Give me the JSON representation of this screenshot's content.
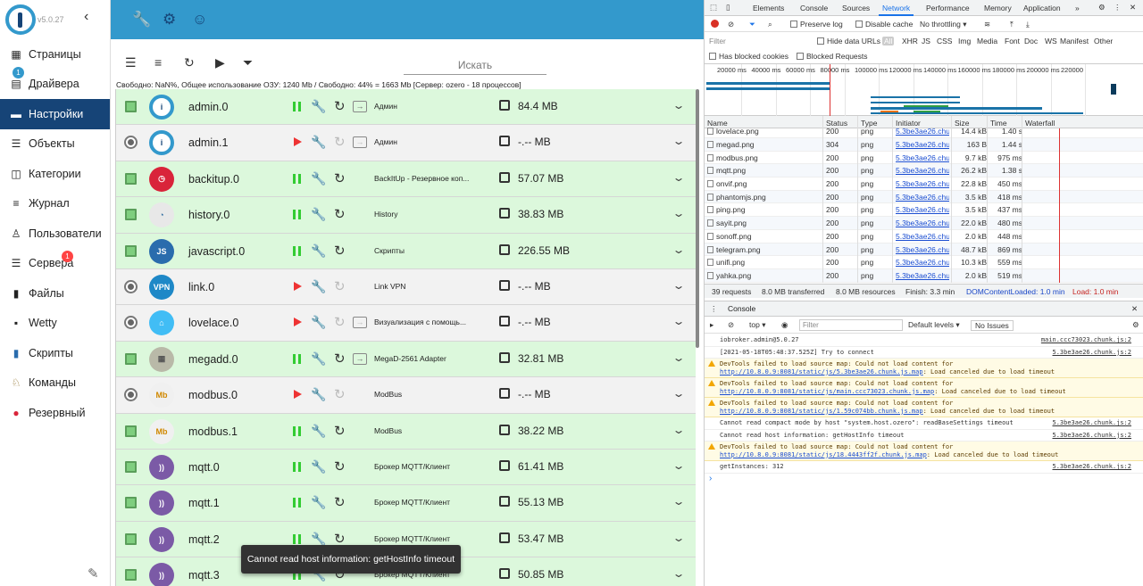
{
  "sidebar": {
    "version": "v5.0.27",
    "items": [
      {
        "label": "Страницы",
        "icon": "grid-icon"
      },
      {
        "label": "Драйвера",
        "icon": "store-icon",
        "badge": "1"
      },
      {
        "label": "Настройки",
        "icon": "list-icon",
        "active": true
      },
      {
        "label": "Объекты",
        "icon": "table-icon"
      },
      {
        "label": "Категории",
        "icon": "tag-icon"
      },
      {
        "label": "Журнал",
        "icon": "log-icon"
      },
      {
        "label": "Пользователи",
        "icon": "user-icon"
      },
      {
        "label": "Сервера",
        "icon": "server-icon",
        "badge": "1"
      },
      {
        "label": "Файлы",
        "icon": "file-icon"
      },
      {
        "label": "Wetty",
        "icon": "terminal-icon"
      },
      {
        "label": "Скрипты",
        "icon": "javascript-icon"
      },
      {
        "label": "Команды",
        "icon": "commands-icon"
      },
      {
        "label": "Резервный",
        "icon": "backup-icon"
      }
    ]
  },
  "main": {
    "search_placeholder": "Искать",
    "status": "Свободно: NaN%, Общее использование ОЗУ: 1240 Mb / Свободно: 44% = 1663 Mb [Сервер: ozero - 18 процессов]",
    "rows": [
      {
        "name": "admin.0",
        "title": "Админ",
        "memory": "84.4 MB",
        "enabled": true,
        "color": "#ffffff",
        "fg": "#164477",
        "glyph": "i"
      },
      {
        "name": "admin.1",
        "title": "Админ",
        "memory": "-.-- MB",
        "enabled": false,
        "color": "#ffffff",
        "fg": "#164477",
        "glyph": "i"
      },
      {
        "name": "backitup.0",
        "title": "BackItUp - Резервное коп...",
        "memory": "57.07 MB",
        "enabled": true,
        "color": "#d9243a",
        "fg": "#fff",
        "glyph": "◷"
      },
      {
        "name": "history.0",
        "title": "History",
        "memory": "38.83 MB",
        "enabled": true,
        "color": "#e8e8e8",
        "fg": "#2d6a9f",
        "glyph": "◔"
      },
      {
        "name": "javascript.0",
        "title": "Скрипты",
        "memory": "226.55 MB",
        "enabled": true,
        "color": "#2a6cad",
        "fg": "#fff",
        "glyph": "JS"
      },
      {
        "name": "link.0",
        "title": "Link VPN",
        "memory": "-.-- MB",
        "enabled": false,
        "color": "#1e88c7",
        "fg": "#fff",
        "glyph": "VPN"
      },
      {
        "name": "lovelace.0",
        "title": "Визуализация с помощь...",
        "memory": "-.-- MB",
        "enabled": false,
        "color": "#41bdf5",
        "fg": "#fff",
        "glyph": "⌂"
      },
      {
        "name": "megadd.0",
        "title": "MegaD-2561 Adapter",
        "memory": "32.81 MB",
        "enabled": true,
        "color": "#b9b9a8",
        "fg": "#555",
        "glyph": "▦"
      },
      {
        "name": "modbus.0",
        "title": "ModBus",
        "memory": "-.-- MB",
        "enabled": false,
        "color": "#f0f0f0",
        "fg": "#d08800",
        "glyph": "Mb"
      },
      {
        "name": "modbus.1",
        "title": "ModBus",
        "memory": "38.22 MB",
        "enabled": true,
        "color": "#f0f0f0",
        "fg": "#d08800",
        "glyph": "Mb"
      },
      {
        "name": "mqtt.0",
        "title": "Брокер MQTT/Клиент",
        "memory": "61.41 MB",
        "enabled": true,
        "color": "#7b5aa6",
        "fg": "#fff",
        "glyph": "))"
      },
      {
        "name": "mqtt.1",
        "title": "Брокер MQTT/Клиент",
        "memory": "55.13 MB",
        "enabled": true,
        "color": "#7b5aa6",
        "fg": "#fff",
        "glyph": "))"
      },
      {
        "name": "mqtt.2",
        "title": "Брокер MQTT/Клиент",
        "memory": "53.47 MB",
        "enabled": true,
        "color": "#7b5aa6",
        "fg": "#fff",
        "glyph": "))"
      },
      {
        "name": "mqtt.3",
        "title": "Брокер MQTT/Клиент",
        "memory": "50.85 MB",
        "enabled": true,
        "color": "#7b5aa6",
        "fg": "#fff",
        "glyph": "))"
      }
    ],
    "toast": "Cannot read host information: getHostInfo timeout"
  },
  "devtools": {
    "tabs": [
      "Elements",
      "Console",
      "Sources",
      "Network",
      "Performance",
      "Memory",
      "Application",
      "»"
    ],
    "active_tab": "Network",
    "toolbar": {
      "preserve_log": "Preserve log",
      "disable_cache": "Disable cache",
      "throttling": "No throttling"
    },
    "filter": {
      "placeholder": "Filter",
      "hide_data_urls": "Hide data URLs",
      "types": [
        "All",
        "XHR",
        "JS",
        "CSS",
        "Img",
        "Media",
        "Font",
        "Doc",
        "WS",
        "Manifest",
        "Other"
      ],
      "has_blocked_cookies": "Has blocked cookies",
      "blocked_requests": "Blocked Requests"
    },
    "timeline_ticks": [
      "20000 ms",
      "40000 ms",
      "60000 ms",
      "80000 ms",
      "100000 ms",
      "120000 ms",
      "140000 ms",
      "160000 ms",
      "180000 ms",
      "200000 ms",
      "220000"
    ],
    "columns": [
      "Name",
      "Status",
      "Type",
      "Initiator",
      "Size",
      "Time",
      "Waterfall"
    ],
    "requests": [
      {
        "name": "lovelace.png",
        "status": "200",
        "type": "png",
        "initiator": "5.3be3ae26.chunk.js:2",
        "size": "14.4 kB",
        "time": "1.40 s"
      },
      {
        "name": "megad.png",
        "status": "304",
        "type": "png",
        "initiator": "5.3be3ae26.chunk.js:2",
        "size": "163 B",
        "time": "1.44 s"
      },
      {
        "name": "modbus.png",
        "status": "200",
        "type": "png",
        "initiator": "5.3be3ae26.chunk.js:2",
        "size": "9.7 kB",
        "time": "975 ms"
      },
      {
        "name": "mqtt.png",
        "status": "200",
        "type": "png",
        "initiator": "5.3be3ae26.chunk.js:2",
        "size": "26.2 kB",
        "time": "1.38 s"
      },
      {
        "name": "onvif.png",
        "status": "200",
        "type": "png",
        "initiator": "5.3be3ae26.chunk.js:2",
        "size": "22.8 kB",
        "time": "450 ms"
      },
      {
        "name": "phantomjs.png",
        "status": "200",
        "type": "png",
        "initiator": "5.3be3ae26.chunk.js:2",
        "size": "3.5 kB",
        "time": "418 ms"
      },
      {
        "name": "ping.png",
        "status": "200",
        "type": "png",
        "initiator": "5.3be3ae26.chunk.js:2",
        "size": "3.5 kB",
        "time": "437 ms"
      },
      {
        "name": "sayit.png",
        "status": "200",
        "type": "png",
        "initiator": "5.3be3ae26.chunk.js:2",
        "size": "22.0 kB",
        "time": "480 ms"
      },
      {
        "name": "sonoff.png",
        "status": "200",
        "type": "png",
        "initiator": "5.3be3ae26.chunk.js:2",
        "size": "2.0 kB",
        "time": "448 ms"
      },
      {
        "name": "telegram.png",
        "status": "200",
        "type": "png",
        "initiator": "5.3be3ae26.chunk.js:2",
        "size": "48.7 kB",
        "time": "869 ms"
      },
      {
        "name": "unifi.png",
        "status": "200",
        "type": "png",
        "initiator": "5.3be3ae26.chunk.js:2",
        "size": "10.3 kB",
        "time": "559 ms"
      },
      {
        "name": "yahka.png",
        "status": "200",
        "type": "png",
        "initiator": "5.3be3ae26.chunk.js:2",
        "size": "2.0 kB",
        "time": "519 ms"
      }
    ],
    "summary": {
      "requests": "39 requests",
      "transferred": "8.0 MB transferred",
      "resources": "8.0 MB resources",
      "finish": "Finish: 3.3 min",
      "dcl": "DOMContentLoaded: 1.0 min",
      "load": "Load: 1.0 min"
    },
    "console": {
      "drawer_tab": "Console",
      "context": "top",
      "filter_placeholder": "Filter",
      "levels": "Default levels",
      "issues": "No Issues",
      "prompt": "›",
      "messages": [
        {
          "level": "info",
          "text": "iobroker.admin@5.0.27",
          "link": "",
          "tail": "",
          "source": "main.ccc73023.chunk.js:2"
        },
        {
          "level": "info",
          "text": "[2021-05-18T05:48:37.525Z] Try to connect",
          "link": "",
          "tail": "",
          "source": "5.3be3ae26.chunk.js:2"
        },
        {
          "level": "warn",
          "text": "DevTools failed to load source map: Could not load content for ",
          "link": "http://10.8.0.9:8081/static/js/5.3be3ae26.chunk.js.map",
          "tail": ": Load canceled due to load timeout",
          "source": ""
        },
        {
          "level": "warn",
          "text": "DevTools failed to load source map: Could not load content for ",
          "link": "http://10.8.0.9:8081/static/js/main.ccc73023.chunk.js.map",
          "tail": ": Load canceled due to load timeout",
          "source": ""
        },
        {
          "level": "warn",
          "text": "DevTools failed to load source map: Could not load content for ",
          "link": "http://10.8.0.9:8081/static/js/1.59c074bb.chunk.js.map",
          "tail": ": Load canceled due to load timeout",
          "source": ""
        },
        {
          "level": "info",
          "text": "Cannot read compact mode by host \"system.host.ozero\": readBaseSettings timeout",
          "link": "",
          "tail": "",
          "source": "5.3be3ae26.chunk.js:2"
        },
        {
          "level": "info",
          "text": "Cannot read host information: getHostInfo timeout",
          "link": "",
          "tail": "",
          "source": "5.3be3ae26.chunk.js:2"
        },
        {
          "level": "warn",
          "text": "DevTools failed to load source map: Could not load content for ",
          "link": "http://10.8.0.9:8081/static/js/18.4443ff2f.chunk.js.map",
          "tail": ": Load canceled due to load timeout",
          "source": ""
        },
        {
          "level": "info",
          "text": "getInstances: 312",
          "link": "",
          "tail": "",
          "source": "5.3be3ae26.chunk.js:2"
        }
      ]
    }
  }
}
